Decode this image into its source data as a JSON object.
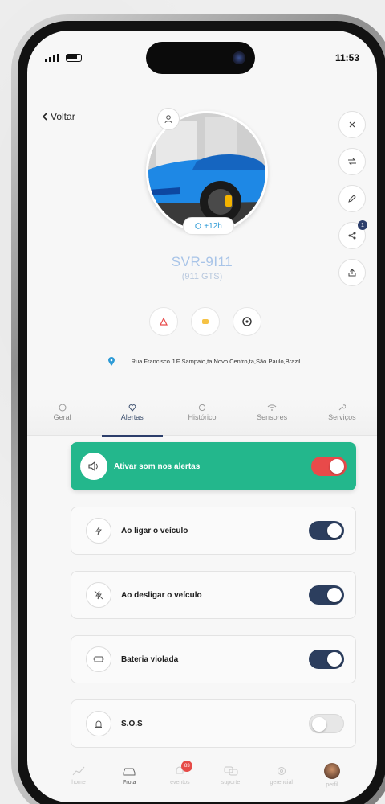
{
  "status_bar": {
    "time": "11:53"
  },
  "header": {
    "back_label": "Voltar"
  },
  "vehicle": {
    "time_badge": "+12h",
    "plate": "SVR-9I11",
    "model": "(911 GTS)",
    "address": "Rua Francisco J F Sampaio,ta Novo Centro,ta,São Paulo,Brazil"
  },
  "tabs": [
    {
      "label": "Geral",
      "icon": "info-icon",
      "active": false
    },
    {
      "label": "Alertas",
      "icon": "heart-icon",
      "active": true
    },
    {
      "label": "Histórico",
      "icon": "history-icon",
      "active": false
    },
    {
      "label": "Sensores",
      "icon": "wifi-icon",
      "active": false
    },
    {
      "label": "Serviços",
      "icon": "wrench-icon",
      "active": false
    }
  ],
  "sound_alert": {
    "label": "Ativar som nos alertas",
    "on": true,
    "color": "#23b78c"
  },
  "alerts": [
    {
      "label": "Ao ligar o veículo",
      "icon": "power-icon",
      "on": true
    },
    {
      "label": "Ao desligar o veículo",
      "icon": "power-off-icon",
      "on": true
    },
    {
      "label": "Bateria violada",
      "icon": "battery-icon",
      "on": true
    },
    {
      "label": "S.O.S",
      "icon": "siren-icon",
      "on": false
    }
  ],
  "side_actions": {
    "share_badge": "1"
  },
  "bottom_nav": [
    {
      "label": "home",
      "icon": "chart-icon",
      "active": false
    },
    {
      "label": "Frota",
      "icon": "car-icon",
      "active": true
    },
    {
      "label": "eventos",
      "icon": "bell-icon",
      "active": false,
      "badge": "83"
    },
    {
      "label": "suporte",
      "icon": "chat-icon",
      "active": false
    },
    {
      "label": "gerencial",
      "icon": "settings-icon",
      "active": false
    },
    {
      "label": "perfil",
      "icon": "profile-icon",
      "active": false
    }
  ],
  "colors": {
    "accent": "#23b78c",
    "navy": "#2c3e5e",
    "red": "#e84a4a"
  }
}
